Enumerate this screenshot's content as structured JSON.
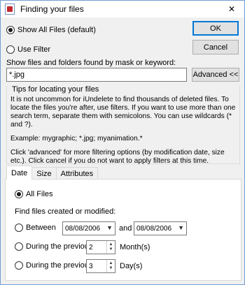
{
  "window": {
    "title": "Finding your files",
    "close_glyph": "✕"
  },
  "mode": {
    "show_all_label": "Show All Files (default)",
    "use_filter_label": "Use Filter",
    "selected": "show_all"
  },
  "buttons": {
    "ok": "OK",
    "cancel": "Cancel",
    "advanced": "Advanced <<"
  },
  "mask": {
    "label": "Show files and folders found by mask or keyword:",
    "value": "*.jpg"
  },
  "tips": {
    "title": "Tips for locating your files",
    "p1": "It is not uncommon for iUndelete to find thousands of deleted files. To locate the files you're after, use filters. If you want to use more than one search term, separate them with semicolons. You can use wildcards (* and ?).",
    "p2": "Example: mygraphic; *.jpg; myanimation.*",
    "p3": "Click 'advanced' for more filtering options (by modification date, size etc.). Click cancel if you do not want to apply filters at this time."
  },
  "tabs": [
    "Date",
    "Size",
    "Attributes"
  ],
  "date_panel": {
    "all_files_label": "All Files",
    "find_label": "Find files created or modified:",
    "between_label": "Between",
    "date_from": "08/08/2006",
    "and_label": "and",
    "date_to": "08/08/2006",
    "prev1_label": "During the previous",
    "prev1_value": "2",
    "prev1_unit": "Month(s)",
    "prev2_label": "During the previous",
    "prev2_value": "3",
    "prev2_unit": "Day(s)"
  }
}
